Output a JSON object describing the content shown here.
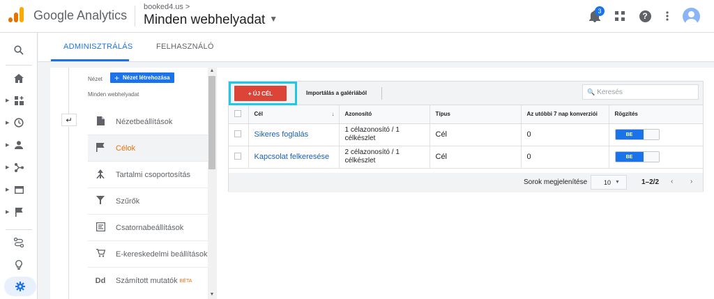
{
  "app": {
    "brand": "Google Analytics",
    "breadcrumb": "booked4.us >",
    "property": "Minden webhelyadat"
  },
  "header": {
    "notification_count": "3"
  },
  "tabs": [
    {
      "label": "ADMINISZTRÁLÁS"
    },
    {
      "label": "FELHASZNÁLÓ"
    }
  ],
  "view": {
    "label": "Nézet",
    "create_button": "Nézet létrehozása",
    "name": "Minden webhelyadat",
    "menu": [
      {
        "label": "Nézetbeállítások",
        "icon": "document-icon"
      },
      {
        "label": "Célok",
        "icon": "flag-icon",
        "active": true
      },
      {
        "label": "Tartalmi csoportosítás",
        "icon": "grouping-icon"
      },
      {
        "label": "Szűrők",
        "icon": "filter-icon"
      },
      {
        "label": "Csatornabeállítások",
        "icon": "channel-settings-icon"
      },
      {
        "label": "E-kereskedelmi beállítások",
        "icon": "cart-icon"
      },
      {
        "label": "Számított mutatók",
        "badge": "BÉTA",
        "icon": "dd-icon"
      }
    ]
  },
  "goals": {
    "new_goal_button": "+ ÚJ CÉL",
    "import_button": "Importálás a galériából",
    "search_placeholder": "Keresés",
    "columns": [
      "Cél",
      "Azonosító",
      "Típus",
      "Az utóbbi 7 nap konverziói",
      "Rögzítés"
    ],
    "rows": [
      {
        "name": "Sikeres foglalás",
        "id": "1 célazonosító / 1 célkészlet",
        "type": "Cél",
        "conversions": "0",
        "recording": "BE"
      },
      {
        "name": "Kapcsolat felkeresése",
        "id": "2 célazonosító / 1 célkészlet",
        "type": "Cél",
        "conversions": "0",
        "recording": "BE"
      }
    ],
    "footer": {
      "rows_label": "Sorok megjelenítése",
      "rows_value": "10",
      "range": "1–2/2"
    }
  },
  "colors": {
    "accent": "#1a73e8",
    "new_goal": "#db4437",
    "active_menu": "#e8710a",
    "highlight": "#1ec9e8"
  }
}
